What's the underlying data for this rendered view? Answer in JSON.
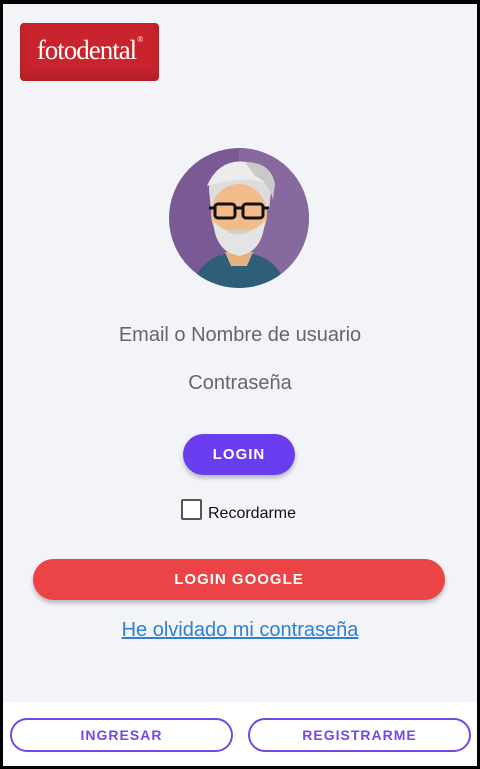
{
  "brand": {
    "logo_text": "fotodental",
    "registered_mark": "®"
  },
  "form": {
    "email_placeholder": "Email o Nombre de usuario",
    "password_placeholder": "Contraseña",
    "login_label": "LOGIN",
    "remember_label": "Recordarme",
    "remember_checked": false,
    "google_label": "LOGIN GOOGLE",
    "forgot_label": "He olvidado mi contraseña"
  },
  "bottom_bar": {
    "ingresar_label": "INGRESAR",
    "registrarme_label": "REGISTRARME"
  },
  "colors": {
    "primary": "#6a3df0",
    "google": "#ec4446",
    "link": "#2f7fd4",
    "logo_bg": "#c9232d"
  }
}
